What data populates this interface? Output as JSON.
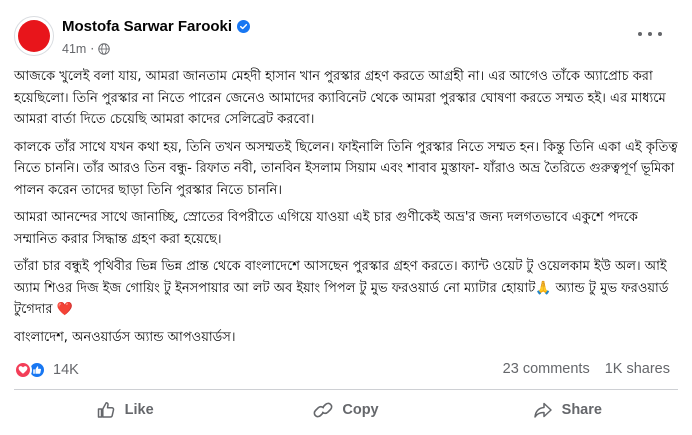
{
  "post": {
    "author": "Mostofa Sarwar Farooki",
    "time": "41m",
    "separator": "·",
    "paragraphs": [
      "আজকে খুলেই বলা যায়, আমরা জানতাম মেহদী হাসান খান পুরস্কার গ্রহণ করতে আগ্রহী না। এর আগেও তাঁকে অ্যাপ্রোচ করা হয়েছিলো। তিনি পুরস্কার না নিতে পারেন জেনেও আমাদের ক্যাবিনেট থেকে আমরা পুরস্কার ঘোষণা করতে সম্মত হই। এর মাধ্যমে আমরা বার্তা দিতে চেয়েছি আমরা কাদের সেলিব্রেট করবো।",
      "কালকে তাঁর সাথে যখন কথা হয়, তিনি তখন অসম্মতই ছিলেন। ফাইনালি তিনি পুরস্কার নিতে সম্মত হন। কিন্তু তিনি একা এই কৃতিত্ব নিতে চাননি। তাঁর আরও তিন বন্ধু- রিফাত নবী, তানবিন ইসলাম সিয়াম এবং শাবাব মুস্তাফা- যাঁরাও অভ্র তৈরিতে গুরুত্বপূর্ণ ভূমিকা পালন করেন তাদের ছাড়া তিনি পুরস্কার নিতে চাননি।",
      "আমরা আনন্দের সাথে জানাচ্ছি, স্রোতের বিপরীতে এগিয়ে যাওয়া এই চার গুণীকেই অভ্র'র জন্য দলগতভাবে একুশে পদকে সম্মানিত করার সিদ্ধান্ত গ্রহণ করা হয়েছে।",
      "তাঁরা চার বন্ধুই পৃথিবীর ভিন্ন ভিন্ন প্রান্ত থেকে বাংলাদেশে আসছেন পুরস্কার গ্রহণ করতে। ক্যান্ট ওয়েট টু ওয়েলকাম ইউ অল। আই অ্যাম শিওর দিজ ইজ গোয়িং টু ইনসপায়ার আ লট অব ইয়াং পিপল টু মুভ ফরওয়ার্ড নো ম্যাটার হোয়াট🙏 অ্যান্ড টু মুভ ফরওয়ার্ড টুগেদার ❤️",
      "বাংলাদেশ, অনওয়ার্ডস অ্যান্ড আপওয়ার্ডস।"
    ]
  },
  "stats": {
    "reactions_count": "14K",
    "comments": "23 comments",
    "shares": "1K shares"
  },
  "actions": {
    "like": "Like",
    "copy": "Copy",
    "share": "Share"
  },
  "colors": {
    "verified": "#1877f2",
    "avatar_red": "#e8151b",
    "love": "#f33e58",
    "like": "#1877f2",
    "secondary_text": "#65676b"
  },
  "icons": [
    "verified-badge-icon",
    "globe-icon",
    "more-options-icon",
    "close-icon",
    "love-reaction-icon",
    "like-reaction-icon",
    "like-icon",
    "copy-icon",
    "share-icon"
  ]
}
